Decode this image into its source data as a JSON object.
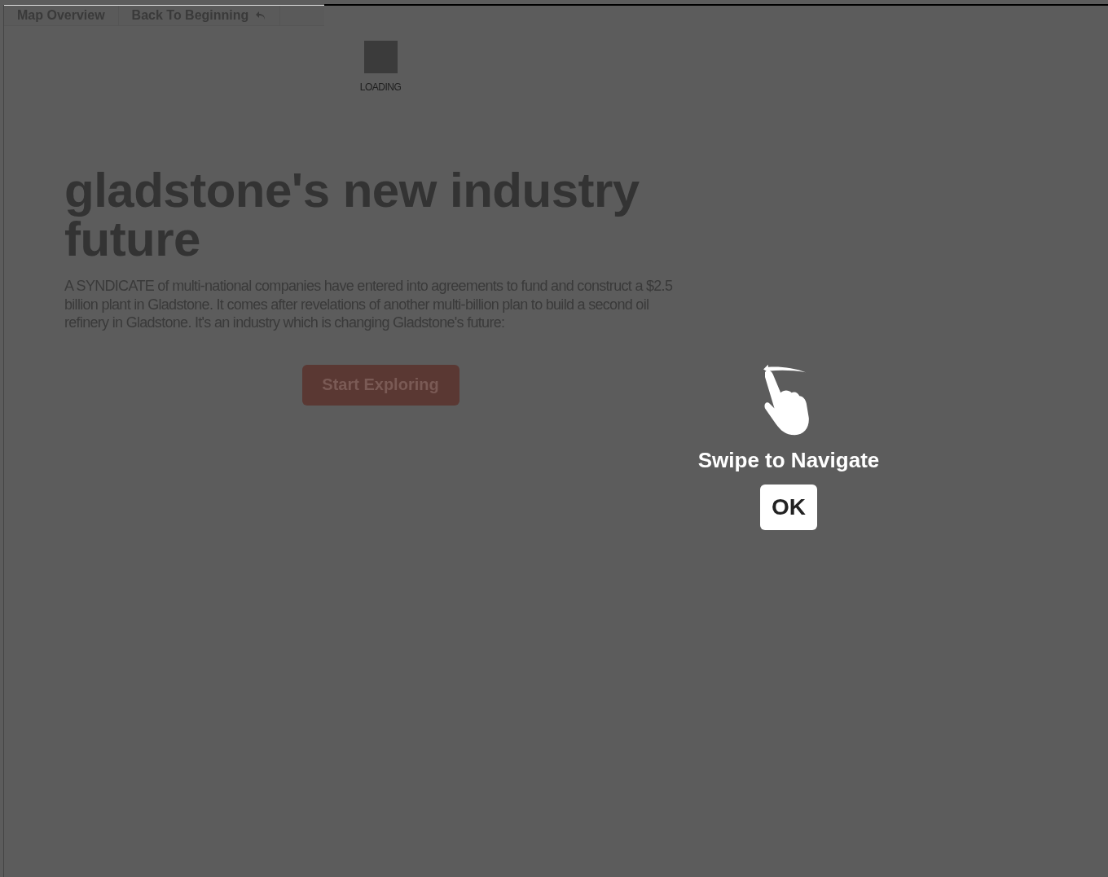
{
  "nav": {
    "items": [
      "Map Overview",
      "Back To Beginning"
    ]
  },
  "loader": {
    "label": "LOADING"
  },
  "article": {
    "title": "gladstone's new industry future",
    "body": "A SYNDICATE of multi-national companies have entered into agreements to fund and construct a $2.5 billion plant in Gladstone. It comes after revelations of another multi-billion plan to build a second oil refinery in Gladstone. It's an industry which is changing Gladstone's future:",
    "button": "Start Exploring"
  },
  "overlay": {
    "message": "Swipe to Navigate",
    "button": "OK"
  }
}
